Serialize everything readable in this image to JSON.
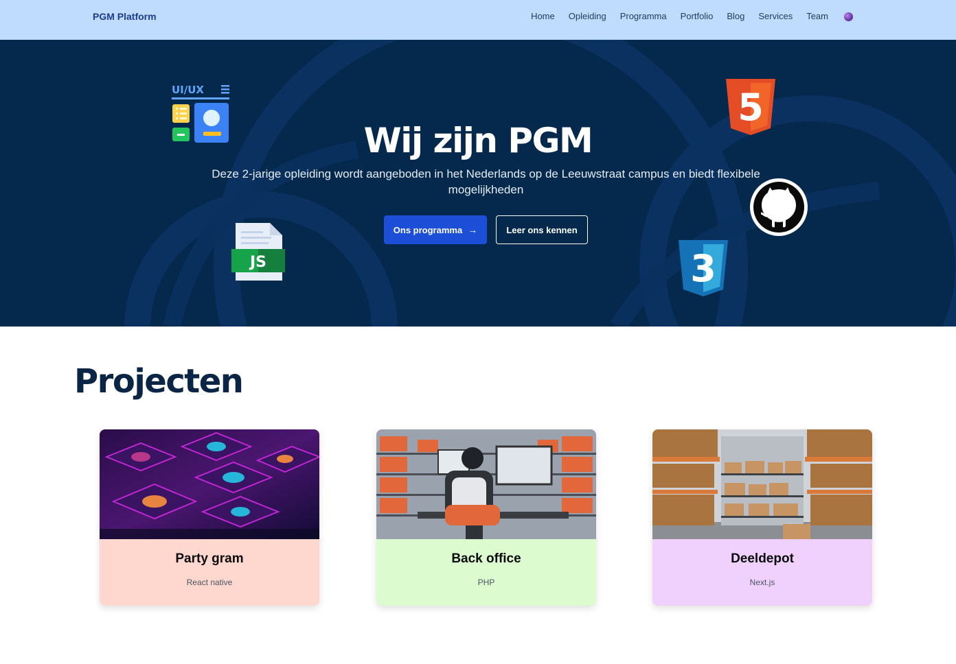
{
  "nav": {
    "brand": "PGM Platform",
    "links": [
      "Home",
      "Opleiding",
      "Programma",
      "Portfolio",
      "Blog",
      "Services",
      "Team"
    ],
    "theme_toggle_icon": "theme-dot-icon"
  },
  "hero": {
    "title": "Wij zijn PGM",
    "subtitle": "Deze 2-jarige opleiding wordt aangeboden in het Nederlands op de Leeuwstraat campus en biedt flexibele mogelijkheden",
    "primary_button": "Ons programma",
    "primary_button_icon": "arrow-right-icon",
    "secondary_button": "Leer ons kennen",
    "uiux_label": "UI/UX",
    "html_label": "5",
    "js_label": "JS",
    "css_label": "3",
    "background_color": "#05284d"
  },
  "projects": {
    "title": "Projecten",
    "cards": [
      {
        "title": "Party gram",
        "tag": "React native",
        "color": "#fed7cf"
      },
      {
        "title": "Back office",
        "tag": "PHP",
        "color": "#dcfccf"
      },
      {
        "title": "Deeldepot",
        "tag": "Next.js",
        "color": "#f0d0fc"
      }
    ]
  }
}
